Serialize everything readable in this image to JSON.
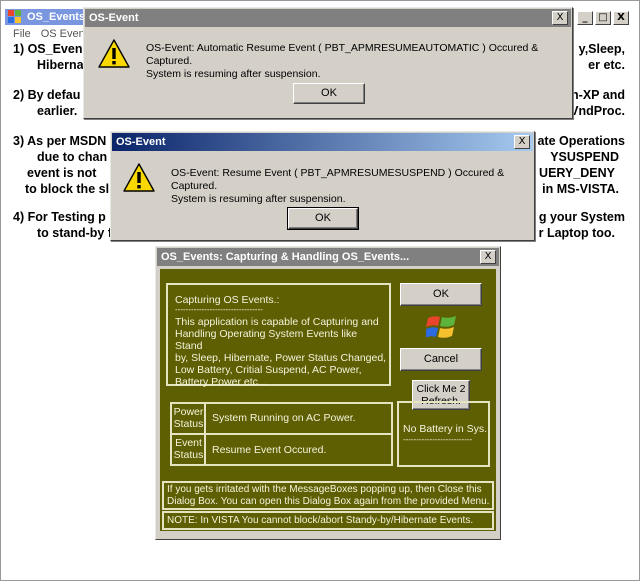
{
  "main_window": {
    "title": "OS_Events",
    "menu": [
      "File",
      "OS Events"
    ],
    "controls": {
      "minimize": "_",
      "maximize": "□",
      "close": "X"
    },
    "paragraphs": {
      "p1": {
        "left_line1": "1) OS_Even",
        "left_line2": "Hiberna",
        "right_line1": "y,Sleep,",
        "right_line2": "er etc."
      },
      "p2": {
        "left_line1": "2) By defau",
        "left_line2": "earlier.",
        "right_line1": "n-XP and",
        "right_line2": "VndProc."
      },
      "p3": {
        "left_line1": "3) As per MSDN",
        "left_line2": "due to chan",
        "left_line3": "event is not",
        "left_line4": "to block the sl",
        "right_line1": "ate Operations",
        "right_line2": "YSUSPEND",
        "right_line3": "UERY_DENY",
        "right_line4": "in MS-VISTA."
      },
      "p4": {
        "left_line1": "4) For Testing p",
        "left_line2": "to stand-by f",
        "right_line1": "g your System",
        "right_line2": "r Laptop too."
      }
    }
  },
  "msgbox1": {
    "title": "OS-Event",
    "close": "X",
    "line1": "OS-Event: Automatic Resume Event ( PBT_APMRESUMEAUTOMATIC ) Occured & Captured.",
    "line2": "System is resuming after suspension.",
    "ok": "OK"
  },
  "msgbox2": {
    "title": "OS-Event",
    "close": "X",
    "line1": "OS-Event: Resume Event ( PBT_APMRESUMESUSPEND ) Occured & Captured.",
    "line2": "System is resuming after suspension.",
    "ok": "OK"
  },
  "os_dialog": {
    "title": "OS_Events: Capturing & Handling OS_Events...",
    "close": "X",
    "info_heading": "Capturing OS Events.:",
    "info_divider": "---------------------------------",
    "info_body": [
      "This application is capable of Capturing and",
      "Handling Operating System Events like Stand",
      "by, Sleep, Hibernate, Power Status Changed,",
      "Low Battery, Critial Suspend, AC Power,",
      "Battery Power etc..."
    ],
    "ok_button": "OK",
    "cancel_button": "Cancel",
    "click_me_line1": "Click Me 2",
    "click_me_line2": "Refresh.",
    "power_label_line1": "Power",
    "power_label_line2": "Status",
    "power_value": "System Running on AC Power.",
    "event_label_line1": "Event",
    "event_label_line2": "Status",
    "event_value": "Resume Event Occured.",
    "battery_text": "No Battery in Sys.",
    "battery_divider": "--------------------------",
    "note1_line1": "If you gets irritated with the MessageBoxes popping up, then Close this",
    "note1_line2": "Dialog Box. You can open this Dialog Box again from the provided Menu.",
    "note2": "NOTE: In VISTA You cannot block/abort Standy-by/Hibernate Events."
  },
  "colors": {
    "olive_bg": "#5e5e03",
    "olive_border": "#e4e4c0",
    "active_title_start": "#0a246a",
    "inactive_title": "#808080",
    "face": "#d4d0c8"
  }
}
